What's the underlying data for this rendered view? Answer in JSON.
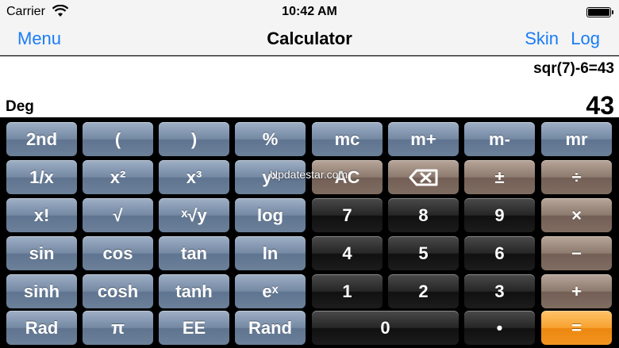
{
  "status_bar": {
    "carrier": "Carrier",
    "time": "10:42 AM"
  },
  "nav": {
    "menu_label": "Menu",
    "title": "Calculator",
    "skin_label": "Skin",
    "log_label": "Log"
  },
  "display": {
    "history": "sqr(7)-6=43",
    "mode": "Deg",
    "result": "43"
  },
  "watermark": "Updatestar.com",
  "keys": {
    "row1": [
      "2nd",
      "(",
      ")",
      "%",
      "mc",
      "m+",
      "m-",
      "mr"
    ],
    "row2": [
      "1/x",
      "x²",
      "x³",
      "yˣ",
      "AC",
      "backspace",
      "±",
      "÷"
    ],
    "row3": [
      "x!",
      "√",
      "ˣ√y",
      "log",
      "7",
      "8",
      "9",
      "×"
    ],
    "row4": [
      "sin",
      "cos",
      "tan",
      "ln",
      "4",
      "5",
      "6",
      "−"
    ],
    "row5": [
      "sinh",
      "cosh",
      "tanh",
      "eˣ",
      "1",
      "2",
      "3",
      "+"
    ],
    "row6": [
      "Rad",
      "π",
      "EE",
      "Rand",
      "0",
      "•",
      "="
    ]
  },
  "colors": {
    "accent": "#1a7cf5",
    "scientific_key": "#7488a3",
    "number_key": "#262626",
    "function_key": "#8c7a6e",
    "equals_key": "#f7a230"
  }
}
